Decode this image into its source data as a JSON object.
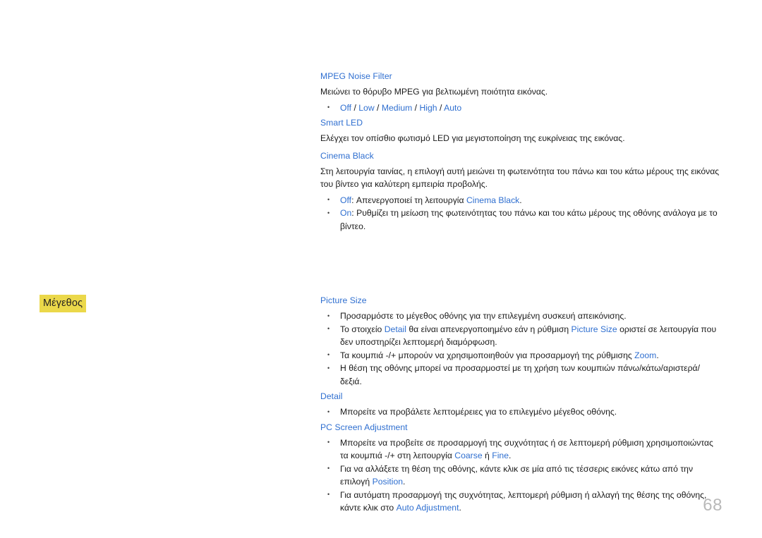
{
  "sidebar": {
    "heading": "Μέγεθος"
  },
  "sections": {
    "mpeg_noise_filter": {
      "title": "MPEG Noise Filter",
      "description": "Μειώνει το θόρυβο MPEG για βελτιωμένη ποιότητα εικόνας.",
      "options": [
        "Off",
        "Low",
        "Medium",
        "High",
        "Auto"
      ],
      "option_separator": " / "
    },
    "smart_led": {
      "title": "Smart LED",
      "description": "Ελέγχει τον οπίσθιο φωτισμό LED για μεγιστοποίηση της ευκρίνειας της εικόνας."
    },
    "cinema_black": {
      "title": "Cinema Black",
      "description": "Στη λειτουργία ταινίας, η επιλογή αυτή μειώνει τη φωτεινότητα του πάνω και του κάτω μέρους της εικόνας του βίντεο για καλύτερη εμπειρία προβολής.",
      "bullet_off_key": "Off",
      "bullet_off_text_a": ": Απενεργοποιεί τη λειτουργία ",
      "bullet_off_link": "Cinema Black",
      "bullet_off_text_b": ".",
      "bullet_on_key": "On",
      "bullet_on_text": ": Ρυθμίζει τη μείωση της φωτεινότητας του πάνω και του κάτω μέρους της οθόνης ανάλογα με το βίντεο."
    },
    "picture_size": {
      "title": "Picture Size",
      "bullet1": "Προσαρμόστε το μέγεθος οθόνης για την επιλεγμένη συσκευή απεικόνισης.",
      "bullet2_a": "Το στοιχείο ",
      "bullet2_link1": "Detail",
      "bullet2_b": " θα είναι απενεργοποιημένο εάν η ρύθμιση ",
      "bullet2_link2": "Picture Size",
      "bullet2_c": " οριστεί σε λειτουργία που δεν υποστηρίζει λεπτομερή διαμόρφωση.",
      "bullet3_a": "Τα κουμπιά -/+ μπορούν να χρησιμοποιηθούν για προσαρμογή της ρύθμισης ",
      "bullet3_link": "Zoom",
      "bullet3_b": ".",
      "bullet4": "Η θέση της οθόνης μπορεί να προσαρμοστεί με τη χρήση των κουμπιών πάνω/κάτω/αριστερά/δεξιά."
    },
    "detail": {
      "title": "Detail",
      "bullet1": "Μπορείτε να προβάλετε λεπτομέρειες για το επιλεγμένο μέγεθος οθόνης."
    },
    "pc_screen_adjustment": {
      "title": "PC Screen Adjustment",
      "bullet1_a": "Μπορείτε να προβείτε σε προσαρμογή της συχνότητας ή σε λεπτομερή ρύθμιση χρησιμοποιώντας τα κουμπιά -/+ στη λειτουργία ",
      "bullet1_link1": "Coarse",
      "bullet1_b": " ή ",
      "bullet1_link2": "Fine",
      "bullet1_c": ".",
      "bullet2_a": "Για να αλλάξετε τη θέση της οθόνης, κάντε κλικ σε μία από τις τέσσερις εικόνες κάτω από την επιλογή ",
      "bullet2_link": "Position",
      "bullet2_b": ".",
      "bullet3_a": "Για αυτόματη προσαρμογή της συχνότητας, λεπτομερή ρύθμιση ή αλλαγή της θέσης της οθόνης, κάντε κλικ στο ",
      "bullet3_link": "Auto Adjustment",
      "bullet3_b": "."
    }
  },
  "footer": {
    "page_number": "68"
  },
  "colors": {
    "link_blue": "#2f6fd0",
    "highlight_yellow": "#ebd84a",
    "body_text": "#1a1a1a",
    "page_number_gray": "#b9b9b9"
  }
}
